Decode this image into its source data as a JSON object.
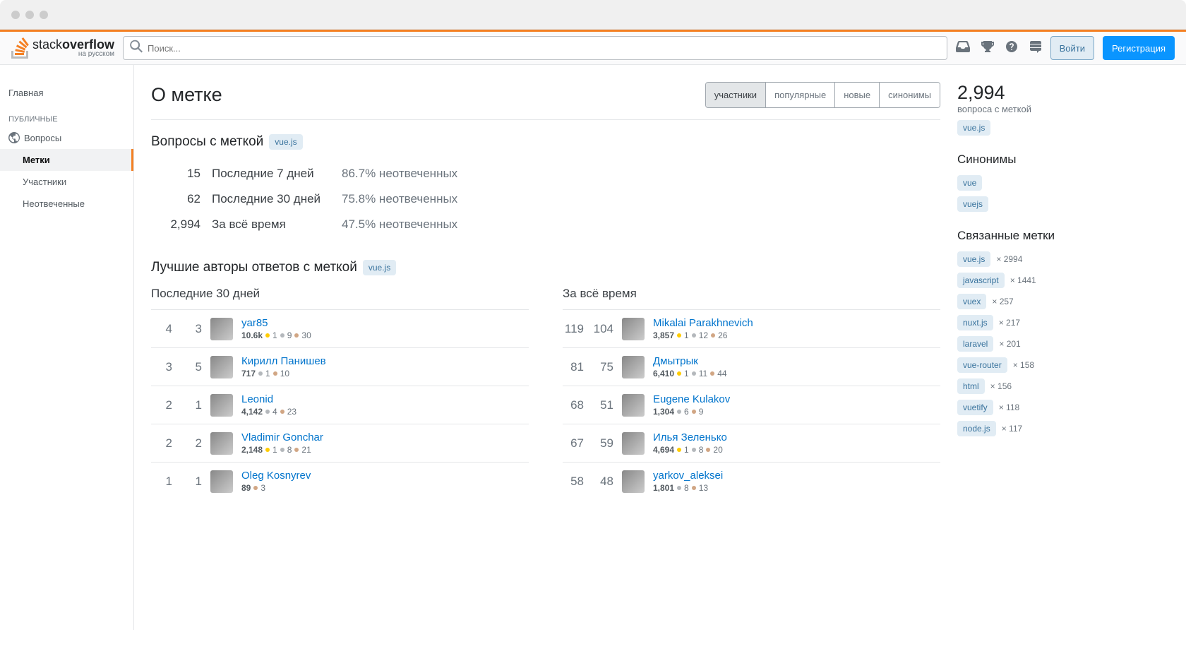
{
  "search": {
    "placeholder": "Поиск..."
  },
  "header": {
    "logo_main_light": "stack",
    "logo_main_bold": "overflow",
    "logo_sub": "на русском",
    "login": "Войти",
    "signup": "Регистрация"
  },
  "sidebar": {
    "home": "Главная",
    "public_heading": "ПУБЛИЧНЫЕ",
    "questions": "Вопросы",
    "tags": "Метки",
    "users": "Участники",
    "unanswered": "Неотвеченные"
  },
  "page": {
    "title": "О метке",
    "tabs": [
      "участники",
      "популярные",
      "новые",
      "синонимы"
    ],
    "active_tab": 0
  },
  "tag_name": "vue.js",
  "questions_section": {
    "title": "Вопросы с меткой",
    "rows": [
      {
        "count": "15",
        "label": "Последние 7 дней",
        "pct": "86.7% неотвеченных"
      },
      {
        "count": "62",
        "label": "Последние 30 дней",
        "pct": "75.8% неотвеченных"
      },
      {
        "count": "2,994",
        "label": "За всё время",
        "pct": "47.5% неотвеченных"
      }
    ]
  },
  "answerers_section": {
    "title": "Лучшие авторы ответов с меткой",
    "col_30_title": "Последние 30 дней",
    "col_all_title": "За всё время",
    "col_30": [
      {
        "a": "4",
        "b": "3",
        "name": "yar85",
        "rep": "10.6k",
        "gold": "1",
        "silver": "9",
        "bronze": "30"
      },
      {
        "a": "3",
        "b": "5",
        "name": "Кирилл Панишев",
        "rep": "717",
        "gold": null,
        "silver": "1",
        "bronze": "10"
      },
      {
        "a": "2",
        "b": "1",
        "name": "Leonid",
        "rep": "4,142",
        "gold": null,
        "silver": "4",
        "bronze": "23"
      },
      {
        "a": "2",
        "b": "2",
        "name": "Vladimir Gonchar",
        "rep": "2,148",
        "gold": "1",
        "silver": "8",
        "bronze": "21"
      },
      {
        "a": "1",
        "b": "1",
        "name": "Oleg Kosnyrev",
        "rep": "89",
        "gold": null,
        "silver": null,
        "bronze": "3"
      }
    ],
    "col_all": [
      {
        "a": "119",
        "b": "104",
        "name": "Mikalai Parakhnevich",
        "rep": "3,857",
        "gold": "1",
        "silver": "12",
        "bronze": "26"
      },
      {
        "a": "81",
        "b": "75",
        "name": "Дмытрык",
        "rep": "6,410",
        "gold": "1",
        "silver": "11",
        "bronze": "44"
      },
      {
        "a": "68",
        "b": "51",
        "name": "Eugene Kulakov",
        "rep": "1,304",
        "gold": null,
        "silver": "6",
        "bronze": "9"
      },
      {
        "a": "67",
        "b": "59",
        "name": "Илья Зеленько",
        "rep": "4,694",
        "gold": "1",
        "silver": "8",
        "bronze": "20"
      },
      {
        "a": "58",
        "b": "48",
        "name": "yarkov_aleksei",
        "rep": "1,801",
        "gold": null,
        "silver": "8",
        "bronze": "13"
      }
    ]
  },
  "rightbar": {
    "total_count": "2,994",
    "total_label": "вопроса с меткой",
    "synonyms_title": "Синонимы",
    "synonyms": [
      "vue",
      "vuejs"
    ],
    "related_title": "Связанные метки",
    "related": [
      {
        "tag": "vue.js",
        "count": "× 2994"
      },
      {
        "tag": "javascript",
        "count": "× 1441"
      },
      {
        "tag": "vuex",
        "count": "× 257"
      },
      {
        "tag": "nuxt.js",
        "count": "× 217"
      },
      {
        "tag": "laravel",
        "count": "× 201"
      },
      {
        "tag": "vue-router",
        "count": "× 158"
      },
      {
        "tag": "html",
        "count": "× 156"
      },
      {
        "tag": "vuetify",
        "count": "× 118"
      },
      {
        "tag": "node.js",
        "count": "× 117"
      }
    ]
  }
}
